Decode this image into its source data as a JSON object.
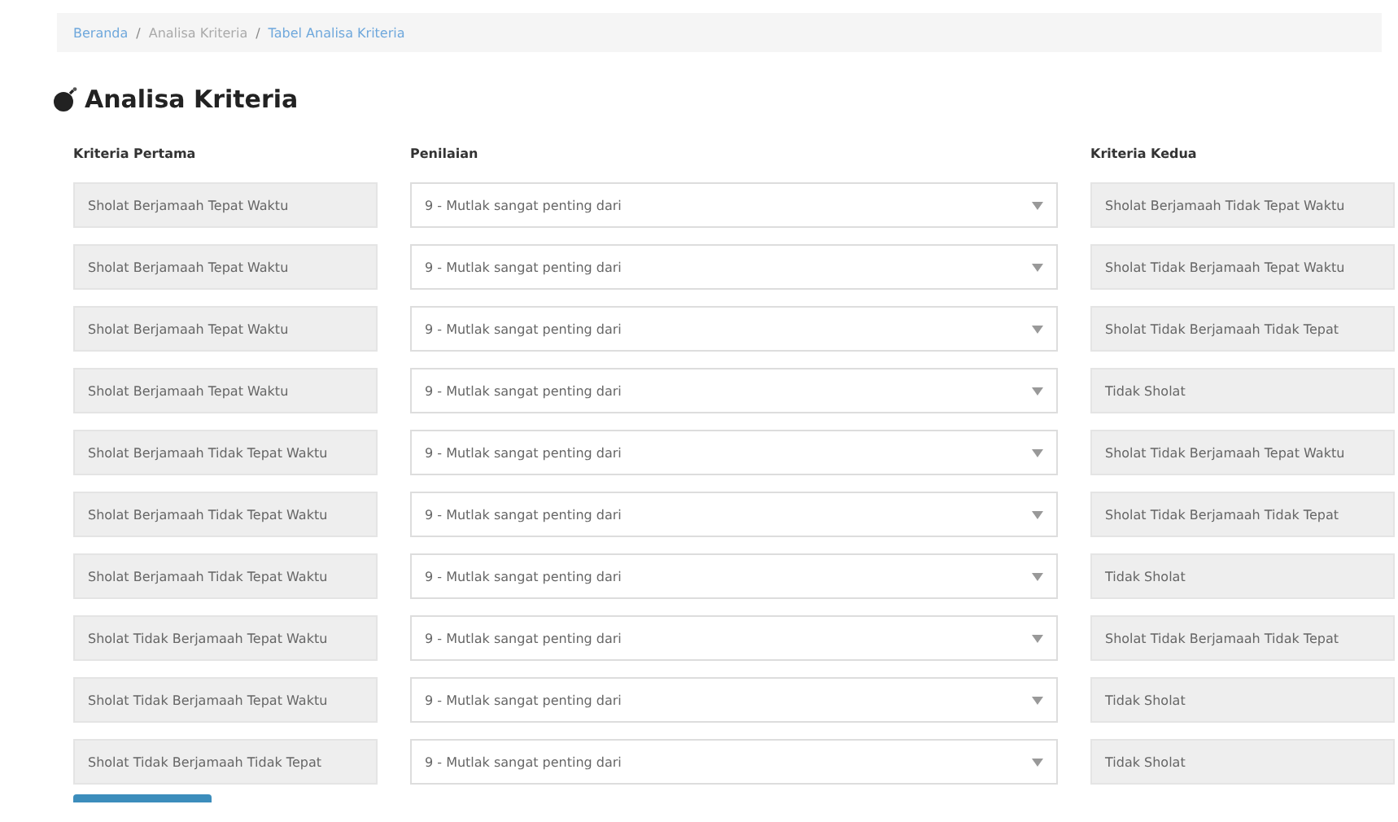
{
  "breadcrumb": [
    {
      "label": "Beranda",
      "kind": "link"
    },
    {
      "separator": "/",
      "label": "Analisa Kriteria",
      "kind": "text"
    },
    {
      "separator": "/",
      "label": "Tabel Analisa Kriteria",
      "kind": "link"
    }
  ],
  "title": "Analisa Kriteria",
  "columns": [
    "Kriteria Pertama",
    "Penilaian",
    "Kriteria Kedua"
  ],
  "rows": [
    {
      "first": "Sholat Berjamaah Tepat Waktu",
      "rating": "9 - Mutlak sangat penting dari",
      "second": "Sholat Berjamaah Tidak Tepat Waktu"
    },
    {
      "first": "Sholat Berjamaah Tepat Waktu",
      "rating": "9 - Mutlak sangat penting dari",
      "second": "Sholat Tidak Berjamaah Tepat Waktu"
    },
    {
      "first": "Sholat Berjamaah Tepat Waktu",
      "rating": "9 - Mutlak sangat penting dari",
      "second": "Sholat Tidak Berjamaah Tidak Tepat"
    },
    {
      "first": "Sholat Berjamaah Tepat Waktu",
      "rating": "9 - Mutlak sangat penting dari",
      "second": "Tidak Sholat"
    },
    {
      "first": "Sholat Berjamaah Tidak Tepat Waktu",
      "rating": "9 - Mutlak sangat penting dari",
      "second": "Sholat Tidak Berjamaah Tepat Waktu"
    },
    {
      "first": "Sholat Berjamaah Tidak Tepat Waktu",
      "rating": "9 - Mutlak sangat penting dari",
      "second": "Sholat Tidak Berjamaah Tidak Tepat"
    },
    {
      "first": "Sholat Berjamaah Tidak Tepat Waktu",
      "rating": "9 - Mutlak sangat penting dari",
      "second": "Tidak Sholat"
    },
    {
      "first": "Sholat Tidak Berjamaah Tepat Waktu",
      "rating": "9 - Mutlak sangat penting dari",
      "second": "Sholat Tidak Berjamaah Tidak Tepat"
    },
    {
      "first": "Sholat Tidak Berjamaah Tepat Waktu",
      "rating": "9 - Mutlak sangat penting dari",
      "second": "Tidak Sholat"
    },
    {
      "first": "Sholat Tidak Berjamaah Tidak Tepat",
      "rating": "9 - Mutlak sangat penting dari",
      "second": "Tidak Sholat"
    }
  ]
}
